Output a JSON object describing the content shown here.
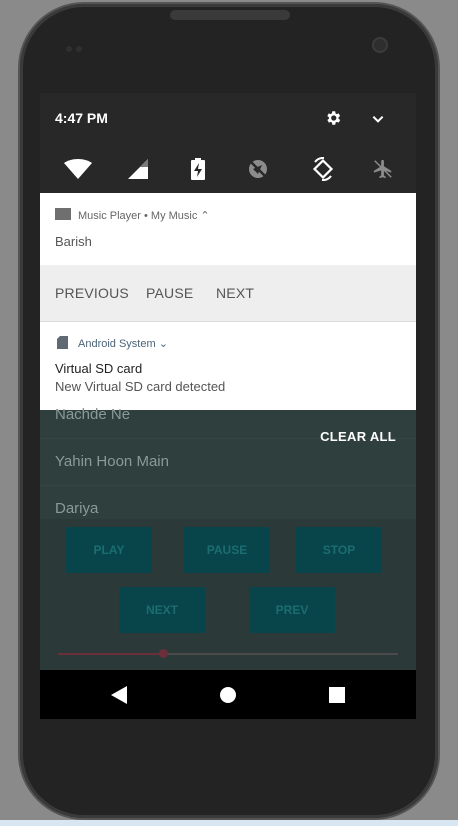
{
  "status_bar": {
    "time": "4:47 PM",
    "icons": [
      "settings-icon",
      "expand-icon"
    ]
  },
  "quick_settings": [
    "wifi-icon",
    "signal-icon",
    "battery-charging-icon",
    "location-off-icon",
    "auto-rotate-icon",
    "airplane-mode-icon"
  ],
  "music_notification": {
    "app_header": "Music Player • My Music ⌃",
    "song": "Barish",
    "actions": [
      "PREVIOUS",
      "PAUSE",
      "NEXT"
    ]
  },
  "system_notification": {
    "app_header": "Android System ⌄",
    "title": "Virtual SD card",
    "text": "New Virtual SD card detected"
  },
  "clear_all": "CLEAR ALL",
  "playlist": [
    "Nachde Ne",
    "Yahin Hoon Main",
    "Dariya"
  ],
  "controls": {
    "play": "PLAY",
    "pause": "PAUSE",
    "stop": "STOP",
    "next": "NEXT",
    "prev": "PREV"
  },
  "seek": {
    "progress": 0.31
  },
  "nav": [
    "back-icon",
    "home-icon",
    "recents-icon"
  ]
}
